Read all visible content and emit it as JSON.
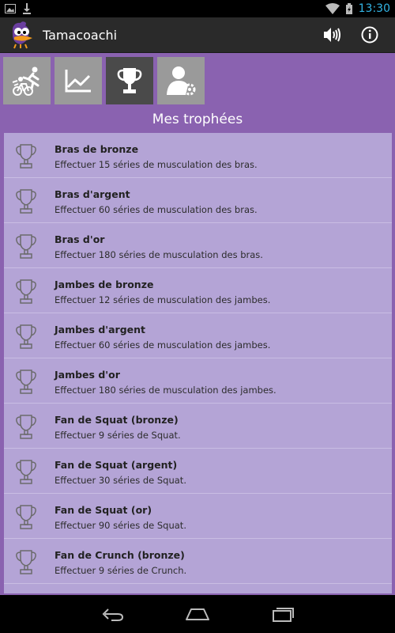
{
  "status": {
    "time": "13:30"
  },
  "app": {
    "title": "Tamacoachi"
  },
  "section": {
    "title": "Mes trophées"
  },
  "tabs": [
    {
      "id": "activity",
      "icon": "runner-cyclist-icon"
    },
    {
      "id": "stats",
      "icon": "chart-line-icon"
    },
    {
      "id": "trophies",
      "icon": "trophy-icon",
      "active": true
    },
    {
      "id": "profile",
      "icon": "user-settings-icon"
    }
  ],
  "trophies": [
    {
      "name": "Bras de bronze",
      "desc": "Effectuer 15 séries de musculation des bras."
    },
    {
      "name": "Bras d'argent",
      "desc": "Effectuer 60 séries de musculation des bras."
    },
    {
      "name": "Bras d'or",
      "desc": "Effectuer 180 séries de musculation des bras."
    },
    {
      "name": "Jambes de bronze",
      "desc": "Effectuer 12 séries de musculation des jambes."
    },
    {
      "name": "Jambes d'argent",
      "desc": "Effectuer 60 séries de musculation des jambes."
    },
    {
      "name": "Jambes d'or",
      "desc": "Effectuer 180 séries de musculation des jambes."
    },
    {
      "name": "Fan de Squat (bronze)",
      "desc": "Effectuer 9 séries de Squat."
    },
    {
      "name": "Fan de Squat (argent)",
      "desc": "Effectuer 30 séries de Squat."
    },
    {
      "name": "Fan de Squat (or)",
      "desc": "Effectuer 90 séries de Squat."
    },
    {
      "name": "Fan de Crunch (bronze)",
      "desc": "Effectuer 9 séries de Crunch."
    }
  ],
  "colors": {
    "background": "#8a62b0",
    "list": "#b4a4d6",
    "accent_time": "#33b5e5"
  }
}
